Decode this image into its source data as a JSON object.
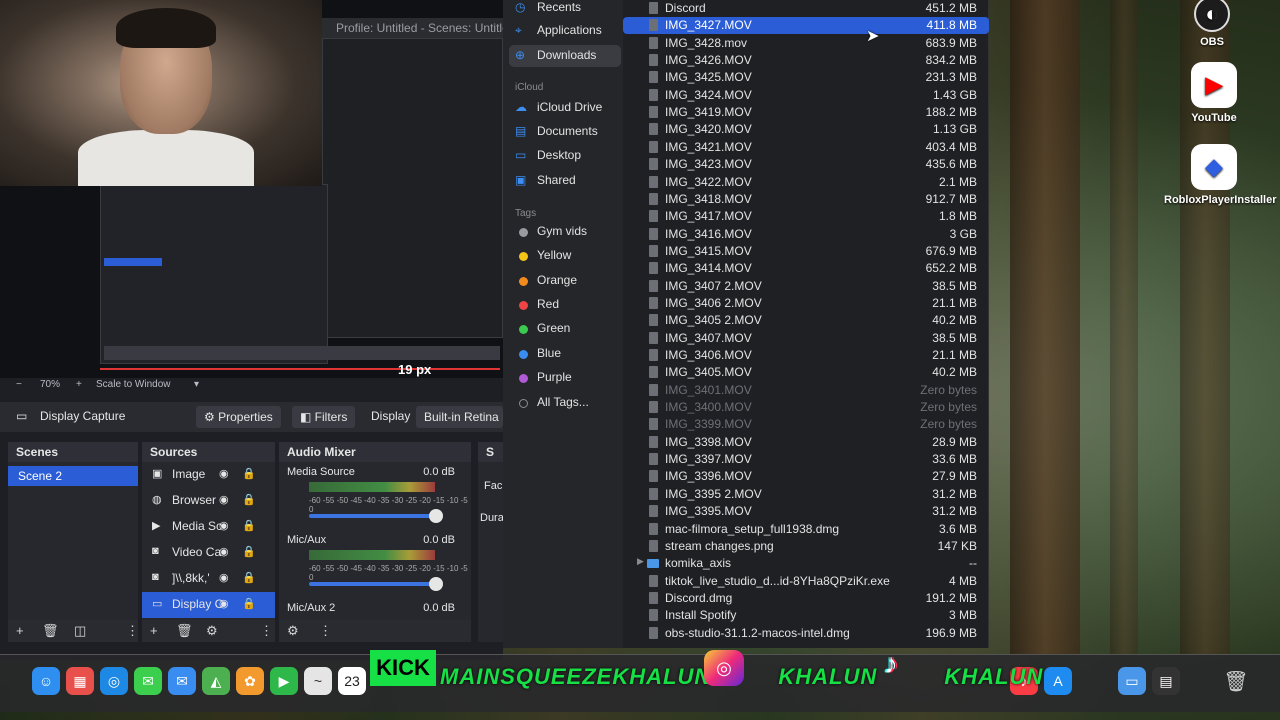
{
  "obs": {
    "preview_title": "Profile: Untitled - Scenes: Untitled",
    "zoom": "70%",
    "scale_mode": "Scale to Window",
    "px_readout": "19 px",
    "toolbar": {
      "source_name": "Display Capture",
      "properties_label": "Properties",
      "filters_label": "Filters",
      "display_label": "Display",
      "display_value": "Built-in Retina Di"
    },
    "scenes": {
      "title": "Scenes",
      "items": [
        "Scene 2"
      ]
    },
    "sources": {
      "title": "Sources",
      "items": [
        {
          "label": "Image",
          "icon": "image-icon"
        },
        {
          "label": "Browser",
          "icon": "globe-icon"
        },
        {
          "label": "Media Sc",
          "icon": "play-icon"
        },
        {
          "label": "Video Ca",
          "icon": "camera-icon"
        },
        {
          "label": "]\\\\,8kk,'",
          "icon": "camera-icon"
        },
        {
          "label": "Display C",
          "icon": "monitor-icon"
        }
      ]
    },
    "mixer": {
      "title": "Audio Mixer",
      "channels": [
        {
          "name": "Media Source",
          "db": "0.0 dB"
        },
        {
          "name": "Mic/Aux",
          "db": "0.0 dB"
        },
        {
          "name": "Mic/Aux 2",
          "db": "0.0 dB"
        }
      ],
      "scale": "-60 -55 -50 -45 -40 -35 -30 -25 -20 -15 -10 -5 0"
    },
    "partial_dock": {
      "title": "S",
      "a": "Fac",
      "b": "Dura"
    }
  },
  "finder": {
    "sidebar": {
      "favorites": [
        {
          "label": "Recents",
          "icon": "clock-icon"
        },
        {
          "label": "Applications",
          "icon": "applications-icon"
        },
        {
          "label": "Downloads",
          "icon": "download-icon"
        }
      ],
      "icloud_header": "iCloud",
      "icloud": [
        {
          "label": "iCloud Drive",
          "icon": "cloud-icon"
        },
        {
          "label": "Documents",
          "icon": "document-icon"
        },
        {
          "label": "Desktop",
          "icon": "desktop-icon"
        },
        {
          "label": "Shared",
          "icon": "shared-folder-icon"
        }
      ],
      "tags_header": "Tags",
      "tags": [
        {
          "label": "Gym vids",
          "color": "#9a9aa0"
        },
        {
          "label": "Yellow",
          "color": "#f5c518"
        },
        {
          "label": "Orange",
          "color": "#f28b1e"
        },
        {
          "label": "Red",
          "color": "#ee4444"
        },
        {
          "label": "Green",
          "color": "#3cc94f"
        },
        {
          "label": "Blue",
          "color": "#3a8df0"
        },
        {
          "label": "Purple",
          "color": "#b05ad8"
        },
        {
          "label": "All Tags...",
          "color": ""
        }
      ]
    },
    "files": [
      {
        "name": "Discord",
        "size": "451.2 MB"
      },
      {
        "name": "IMG_3427.MOV",
        "size": "411.8 MB",
        "selected": true
      },
      {
        "name": "IMG_3428.mov",
        "size": "683.9 MB"
      },
      {
        "name": "IMG_3426.MOV",
        "size": "834.2 MB"
      },
      {
        "name": "IMG_3425.MOV",
        "size": "231.3 MB"
      },
      {
        "name": "IMG_3424.MOV",
        "size": "1.43 GB"
      },
      {
        "name": "IMG_3419.MOV",
        "size": "188.2 MB"
      },
      {
        "name": "IMG_3420.MOV",
        "size": "1.13 GB"
      },
      {
        "name": "IMG_3421.MOV",
        "size": "403.4 MB"
      },
      {
        "name": "IMG_3423.MOV",
        "size": "435.6 MB"
      },
      {
        "name": "IMG_3422.MOV",
        "size": "2.1 MB"
      },
      {
        "name": "IMG_3418.MOV",
        "size": "912.7 MB"
      },
      {
        "name": "IMG_3417.MOV",
        "size": "1.8 MB"
      },
      {
        "name": "IMG_3416.MOV",
        "size": "3 GB"
      },
      {
        "name": "IMG_3415.MOV",
        "size": "676.9 MB"
      },
      {
        "name": "IMG_3414.MOV",
        "size": "652.2 MB"
      },
      {
        "name": "IMG_3407 2.MOV",
        "size": "38.5 MB"
      },
      {
        "name": "IMG_3406 2.MOV",
        "size": "21.1 MB"
      },
      {
        "name": "IMG_3405 2.MOV",
        "size": "40.2 MB"
      },
      {
        "name": "IMG_3407.MOV",
        "size": "38.5 MB"
      },
      {
        "name": "IMG_3406.MOV",
        "size": "21.1 MB"
      },
      {
        "name": "IMG_3405.MOV",
        "size": "40.2 MB"
      },
      {
        "name": "IMG_3401.MOV",
        "size": "Zero bytes",
        "dim": true
      },
      {
        "name": "IMG_3400.MOV",
        "size": "Zero bytes",
        "dim": true
      },
      {
        "name": "IMG_3399.MOV",
        "size": "Zero bytes",
        "dim": true
      },
      {
        "name": "IMG_3398.MOV",
        "size": "28.9 MB"
      },
      {
        "name": "IMG_3397.MOV",
        "size": "33.6 MB"
      },
      {
        "name": "IMG_3396.MOV",
        "size": "27.9 MB"
      },
      {
        "name": "IMG_3395 2.MOV",
        "size": "31.2 MB"
      },
      {
        "name": "IMG_3395.MOV",
        "size": "31.2 MB"
      },
      {
        "name": "mac-filmora_setup_full1938.dmg",
        "size": "3.6 MB"
      },
      {
        "name": "stream changes.png",
        "size": "147 KB"
      },
      {
        "name": "komika_axis",
        "size": "--",
        "folder": true
      },
      {
        "name": "tiktok_live_studio_d...id-8YHa8QPziKr.exe",
        "size": "4 MB"
      },
      {
        "name": "Discord.dmg",
        "size": "191.2 MB"
      },
      {
        "name": "Install Spotify",
        "size": "3 MB"
      },
      {
        "name": "obs-studio-31.1.2-macos-intel.dmg",
        "size": "196.9 MB"
      }
    ]
  },
  "desktop_icons": [
    {
      "label": "OBS",
      "icon": "obs-icon",
      "color": "#1c1c1c"
    },
    {
      "label": "YouTube",
      "icon": "youtube-icon",
      "color": "#ffffff"
    },
    {
      "label": "RobloxPlayerInstaller",
      "icon": "roblox-icon",
      "color": "#ffffff"
    }
  ],
  "dock": {
    "kick_label": "KICK",
    "overlay_text": "MAINSQUEEZEKHALUN",
    "overlay_text_2": "KHALUN",
    "overlay_text_3": "KHALUN",
    "calendar_day": "23"
  }
}
